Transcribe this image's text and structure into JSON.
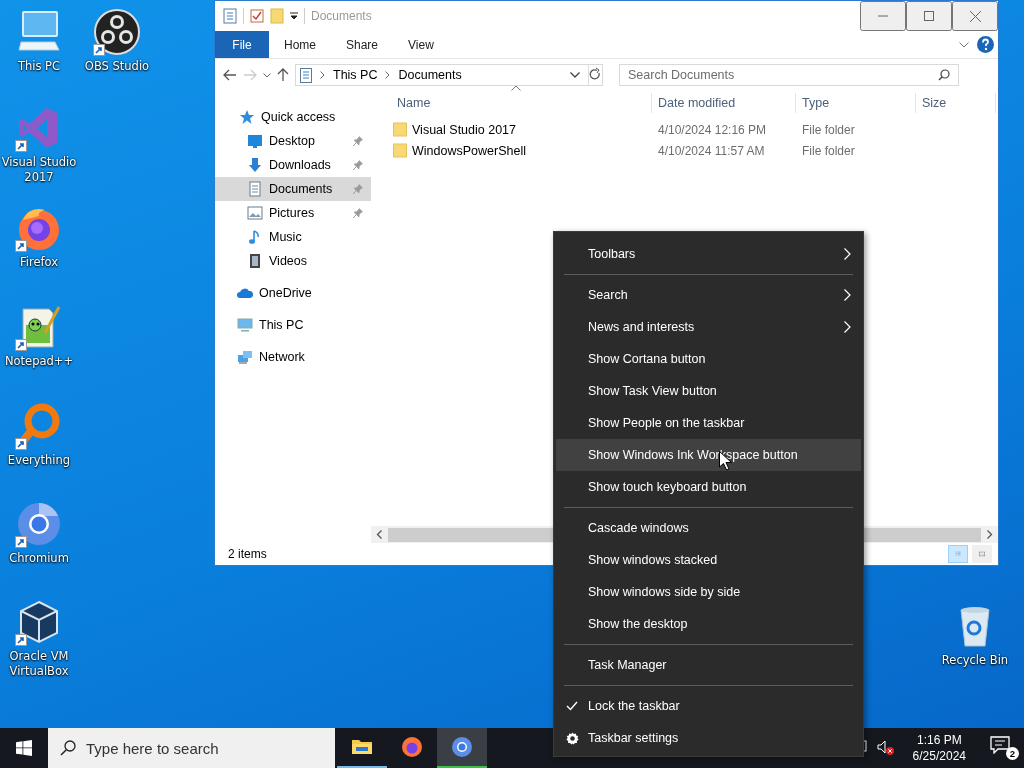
{
  "desktop_icons": [
    {
      "label": "This PC",
      "kind": "pc",
      "shortcut": false
    },
    {
      "label": "OBS Studio",
      "kind": "obs",
      "shortcut": true
    },
    {
      "label": "Visual Studio 2017",
      "kind": "vs",
      "shortcut": true
    },
    {
      "label": "Firefox",
      "kind": "firefox",
      "shortcut": true
    },
    {
      "label": "Notepad++",
      "kind": "notepad",
      "shortcut": true
    },
    {
      "label": "Everything",
      "kind": "everything",
      "shortcut": true
    },
    {
      "label": "Chromium",
      "kind": "chromium",
      "shortcut": true
    },
    {
      "label": "Oracle VM VirtualBox",
      "kind": "virtualbox",
      "shortcut": true
    },
    {
      "label": "Recycle Bin",
      "kind": "recycle",
      "shortcut": false
    }
  ],
  "explorer": {
    "title": "Documents",
    "file_tab": "File",
    "ribbon_tabs": [
      "Home",
      "Share",
      "View"
    ],
    "breadcrumbs": [
      "This PC",
      "Documents"
    ],
    "search": {
      "placeholder": "Search Documents"
    },
    "navigation": [
      {
        "label": "Quick access",
        "kind": "star",
        "selected": false,
        "pinned": false,
        "children": [
          {
            "label": "Desktop",
            "kind": "desktop",
            "selected": false,
            "pinned": true
          },
          {
            "label": "Downloads",
            "kind": "download",
            "selected": false,
            "pinned": true
          },
          {
            "label": "Documents",
            "kind": "document",
            "selected": true,
            "pinned": true
          },
          {
            "label": "Pictures",
            "kind": "picture",
            "selected": false,
            "pinned": true
          },
          {
            "label": "Music",
            "kind": "music",
            "selected": false,
            "pinned": false
          },
          {
            "label": "Videos",
            "kind": "video",
            "selected": false,
            "pinned": false
          }
        ]
      },
      {
        "label": "OneDrive",
        "kind": "cloud",
        "selected": false,
        "pinned": false
      },
      {
        "label": "This PC",
        "kind": "pc",
        "selected": false,
        "pinned": false
      },
      {
        "label": "Network",
        "kind": "network",
        "selected": false,
        "pinned": false
      }
    ],
    "columns": [
      "Name",
      "Date modified",
      "Type",
      "Size"
    ],
    "rows": [
      {
        "name": "Visual Studio 2017",
        "date": "4/10/2024 12:16 PM",
        "type": "File folder"
      },
      {
        "name": "WindowsPowerShell",
        "date": "4/10/2024 11:57 AM",
        "type": "File folder"
      }
    ],
    "status": "2 items"
  },
  "context_menu": {
    "sections": [
      [
        {
          "label": "Toolbars",
          "kind": "submenu",
          "checked": false,
          "selected": false
        }
      ],
      [
        {
          "label": "Search",
          "kind": "submenu",
          "checked": false,
          "selected": false
        },
        {
          "label": "News and interests",
          "kind": "submenu",
          "checked": false,
          "selected": false
        },
        {
          "label": "Show Cortana button",
          "kind": "command",
          "checked": false,
          "selected": false
        },
        {
          "label": "Show Task View button",
          "kind": "command",
          "checked": false,
          "selected": false
        },
        {
          "label": "Show People on the taskbar",
          "kind": "command",
          "checked": false,
          "selected": false
        },
        {
          "label": "Show Windows Ink Workspace button",
          "kind": "command",
          "checked": false,
          "selected": true
        },
        {
          "label": "Show touch keyboard button",
          "kind": "command",
          "checked": false,
          "selected": false
        }
      ],
      [
        {
          "label": "Cascade windows",
          "kind": "command",
          "checked": false,
          "selected": false
        },
        {
          "label": "Show windows stacked",
          "kind": "command",
          "checked": false,
          "selected": false
        },
        {
          "label": "Show windows side by side",
          "kind": "command",
          "checked": false,
          "selected": false
        },
        {
          "label": "Show the desktop",
          "kind": "command",
          "checked": false,
          "selected": false
        }
      ],
      [
        {
          "label": "Task Manager",
          "kind": "command",
          "checked": false,
          "selected": false
        }
      ],
      [
        {
          "label": "Lock the taskbar",
          "kind": "command",
          "checked": true,
          "selected": false
        },
        {
          "label": "Taskbar settings",
          "kind": "settings",
          "checked": false,
          "selected": false
        }
      ]
    ]
  },
  "taskbar": {
    "search": {
      "placeholder": "Type here to search"
    },
    "apps": [
      {
        "kind": "explorer",
        "running": true,
        "selected": false
      },
      {
        "kind": "firefox",
        "running": false,
        "selected": false
      },
      {
        "kind": "chromium",
        "running": true,
        "selected": true
      }
    ],
    "time": "1:16 PM",
    "date": "6/25/2024",
    "notification_count": "2"
  }
}
